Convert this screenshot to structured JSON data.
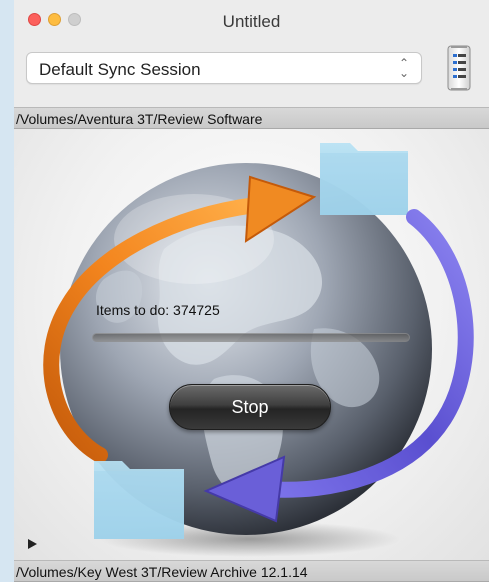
{
  "window": {
    "title": "Untitled"
  },
  "session": {
    "selected": "Default Sync Session"
  },
  "source_path": "/Volumes/Aventura 3T/Review Software",
  "destination_path": "/Volumes/Key West 3T/Review Archive 12.1.14",
  "status": {
    "items_label": "Items to do: 374725",
    "progress_percent": 0
  },
  "stop_button": {
    "label": "Stop"
  },
  "icons": {
    "traffic_lights": [
      "close-icon",
      "minimize-icon",
      "zoom-icon"
    ],
    "session_list": "list-icon",
    "globe": "globe-icon",
    "folders": "folder-icon",
    "arrows": "sync-arrow-icon",
    "disclosure": "disclosure-triangle-icon"
  },
  "colors": {
    "close": "#fc605c",
    "minimize": "#fdbc40",
    "zoom": "#cfcfcf",
    "orange_arrow": "#f07a1a",
    "purple_arrow": "#6a5fd8",
    "folder": "#9fd2ea"
  }
}
